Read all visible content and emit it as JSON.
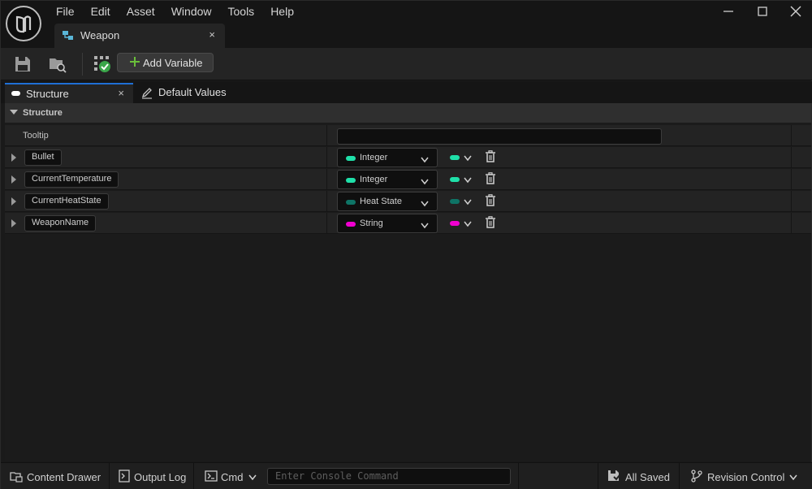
{
  "menu": [
    "File",
    "Edit",
    "Asset",
    "Window",
    "Tools",
    "Help"
  ],
  "document_tab": {
    "label": "Weapon",
    "close": "×"
  },
  "toolbar": {
    "add_variable_label": "Add Variable"
  },
  "panel_tabs": {
    "structure": "Structure",
    "structure_close": "×",
    "default_values": "Default Values"
  },
  "section": {
    "title": "Structure"
  },
  "tooltip_row": {
    "label": "Tooltip",
    "value": ""
  },
  "variables": [
    {
      "name": "Bullet",
      "type": "Integer",
      "color": "#1fe0a9"
    },
    {
      "name": "CurrentTemperature",
      "type": "Integer",
      "color": "#1fe0a9"
    },
    {
      "name": "CurrentHeatState",
      "type": "Heat State",
      "color": "#0e7466"
    },
    {
      "name": "WeaponName",
      "type": "String",
      "color": "#f000d0"
    }
  ],
  "statusbar": {
    "content_drawer": "Content Drawer",
    "output_log": "Output Log",
    "cmd": "Cmd",
    "console_placeholder": "Enter Console Command",
    "save_state": "All Saved",
    "revision_control": "Revision Control"
  },
  "colors": {
    "accent_blue": "#1f6fd6",
    "add_green": "#6abf3a"
  }
}
